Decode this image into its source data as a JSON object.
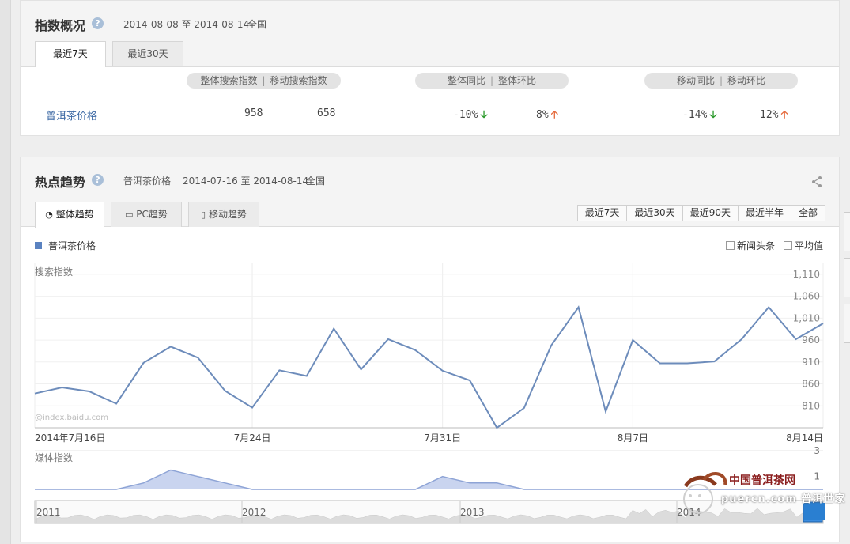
{
  "overview": {
    "title": "指数概况",
    "help_icon": "?",
    "date_range": "2014-08-08 至 2014-08-14",
    "region": "全国",
    "tabs": [
      "最近7天",
      "最近30天"
    ],
    "headers": {
      "group1": [
        "整体搜索指数",
        "移动搜索指数"
      ],
      "group2": [
        "整体同比",
        "整体环比"
      ],
      "group3": [
        "移动同比",
        "移动环比"
      ],
      "separator": "|"
    },
    "row": {
      "keyword": "普洱茶价格",
      "overall_search": "958",
      "mobile_search": "658",
      "overall_yoy": "-10%",
      "overall_mom": "8%",
      "mobile_yoy": "-14%",
      "mobile_mom": "12%"
    },
    "arrows": {
      "down": "🡣",
      "up": "🡡"
    }
  },
  "trend": {
    "title": "热点趋势",
    "help_icon": "?",
    "keyword": "普洱茶价格",
    "date_range": "2014-07-16 至 2014-08-14",
    "region": "全国",
    "tabs": [
      "整体趋势",
      "PC趋势",
      "移动趋势"
    ],
    "ranges": [
      "最近7天",
      "最近30天",
      "最近90天",
      "最近半年",
      "全部"
    ],
    "legend": "普洱茶价格",
    "checkboxes": [
      "新闻头条",
      "平均值"
    ],
    "watermark": "@index.baidu.com",
    "logo_text": "中国普洱茶网",
    "logo_url": "puercn.com",
    "logo_overlay": "普洱世家"
  },
  "chart_data": [
    {
      "type": "line",
      "title": "搜索指数",
      "x_tick_labels": [
        "2014年7月16日",
        "7月24日",
        "7月31日",
        "8月7日",
        "8月14日"
      ],
      "y_tick_labels": [
        "1,110",
        "1,060",
        "1,010",
        "960",
        "910",
        "860",
        "810"
      ],
      "ylim": [
        760,
        1135
      ],
      "grid": true,
      "series": [
        {
          "name": "普洱茶价格",
          "color": "#6d8cbb",
          "values": [
            838,
            852,
            843,
            815,
            908,
            945,
            920,
            844,
            806,
            891,
            878,
            986,
            893,
            962,
            937,
            890,
            868,
            760,
            805,
            948,
            1035,
            797,
            960,
            907,
            907,
            911,
            962,
            1035,
            962,
            998
          ]
        }
      ]
    },
    {
      "type": "area",
      "title": "媒体指数",
      "y_tick_labels": [
        "3",
        "1"
      ],
      "ylim": [
        0,
        3
      ],
      "series": [
        {
          "name": "普洱茶价格",
          "color": "#8ea4d6",
          "values": [
            0,
            0,
            0,
            0,
            0.5,
            1.5,
            1.0,
            0.5,
            0,
            0,
            0,
            0,
            0,
            0,
            0,
            1.0,
            0.5,
            0.5,
            0,
            0,
            0,
            0,
            0,
            0,
            0,
            0,
            0,
            0,
            0,
            0
          ]
        }
      ]
    }
  ],
  "navigator": {
    "years": [
      "2011",
      "2012",
      "2013",
      "2014"
    ]
  }
}
